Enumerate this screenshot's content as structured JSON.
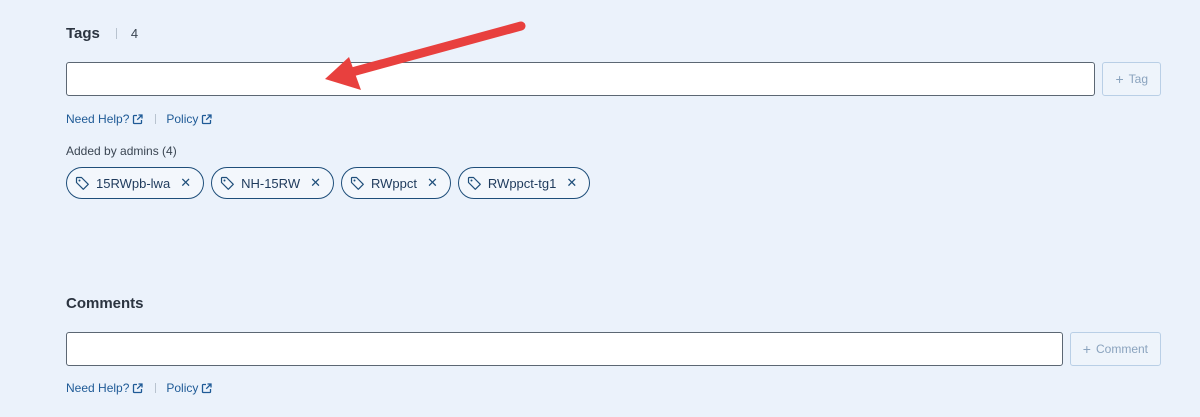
{
  "tags": {
    "title": "Tags",
    "count": "4",
    "input_value": "",
    "add_button_label": "Tag",
    "help_link": "Need Help?",
    "policy_link": "Policy",
    "added_by_label": "Added by admins (4)",
    "items": [
      {
        "label": "15RWpb-lwa"
      },
      {
        "label": "NH-15RW"
      },
      {
        "label": "RWppct"
      },
      {
        "label": "RWppct-tg1"
      }
    ]
  },
  "comments": {
    "title": "Comments",
    "input_value": "",
    "add_button_label": "Comment",
    "help_link": "Need Help?",
    "policy_link": "Policy"
  },
  "annotation": {
    "arrow_color": "#e8403e"
  },
  "colors": {
    "background": "#ebf2fb",
    "link": "#1e5a96",
    "chip_border": "#1e4e7a"
  }
}
